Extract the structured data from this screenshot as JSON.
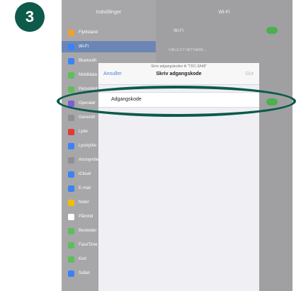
{
  "step_number": "3",
  "sidebar": {
    "title": "Indstillinger",
    "items": [
      {
        "label": "Flytilstand",
        "color": "#f0a030"
      },
      {
        "label": "Wi-Fi",
        "color": "#3b82f6",
        "active": true
      },
      {
        "label": "Bluetooth",
        "color": "#3b82f6"
      },
      {
        "label": "Mobildata",
        "color": "#5bbf5b"
      },
      {
        "label": "Personligt hotspot",
        "color": "#5bbf5b"
      },
      {
        "label": "Operatør",
        "color": "#7b5fd6"
      },
      {
        "label": "Generelt",
        "color": "#8e8e93"
      },
      {
        "label": "Lyde",
        "color": "#e53935"
      },
      {
        "label": "Lysstyrke",
        "color": "#3b82f6"
      },
      {
        "label": "Anonymitet",
        "color": "#8e8e93"
      },
      {
        "label": "iCloud",
        "color": "#3b82f6"
      },
      {
        "label": "E-mail",
        "color": "#3b82f6"
      },
      {
        "label": "Noter",
        "color": "#f0c000"
      },
      {
        "label": "Påmind",
        "color": "#ffffff"
      },
      {
        "label": "Beskeder",
        "color": "#5bbf5b"
      },
      {
        "label": "FaceTime",
        "color": "#5bbf5b"
      },
      {
        "label": "Kort",
        "color": "#5bbf5b"
      },
      {
        "label": "Safari",
        "color": "#3b82f6"
      }
    ]
  },
  "detail": {
    "title": "Wi-Fi",
    "wifi_label": "Wi-Fi",
    "section_label": "VÆLG ET NETVÆRK..."
  },
  "modal": {
    "subtitle": "Skriv adgangskoden til \"TDC-3A48\"",
    "title": "Skriv adgangskode",
    "cancel_label": "Annuller",
    "join_label": "Slut",
    "password_placeholder": "Adgangskode"
  }
}
